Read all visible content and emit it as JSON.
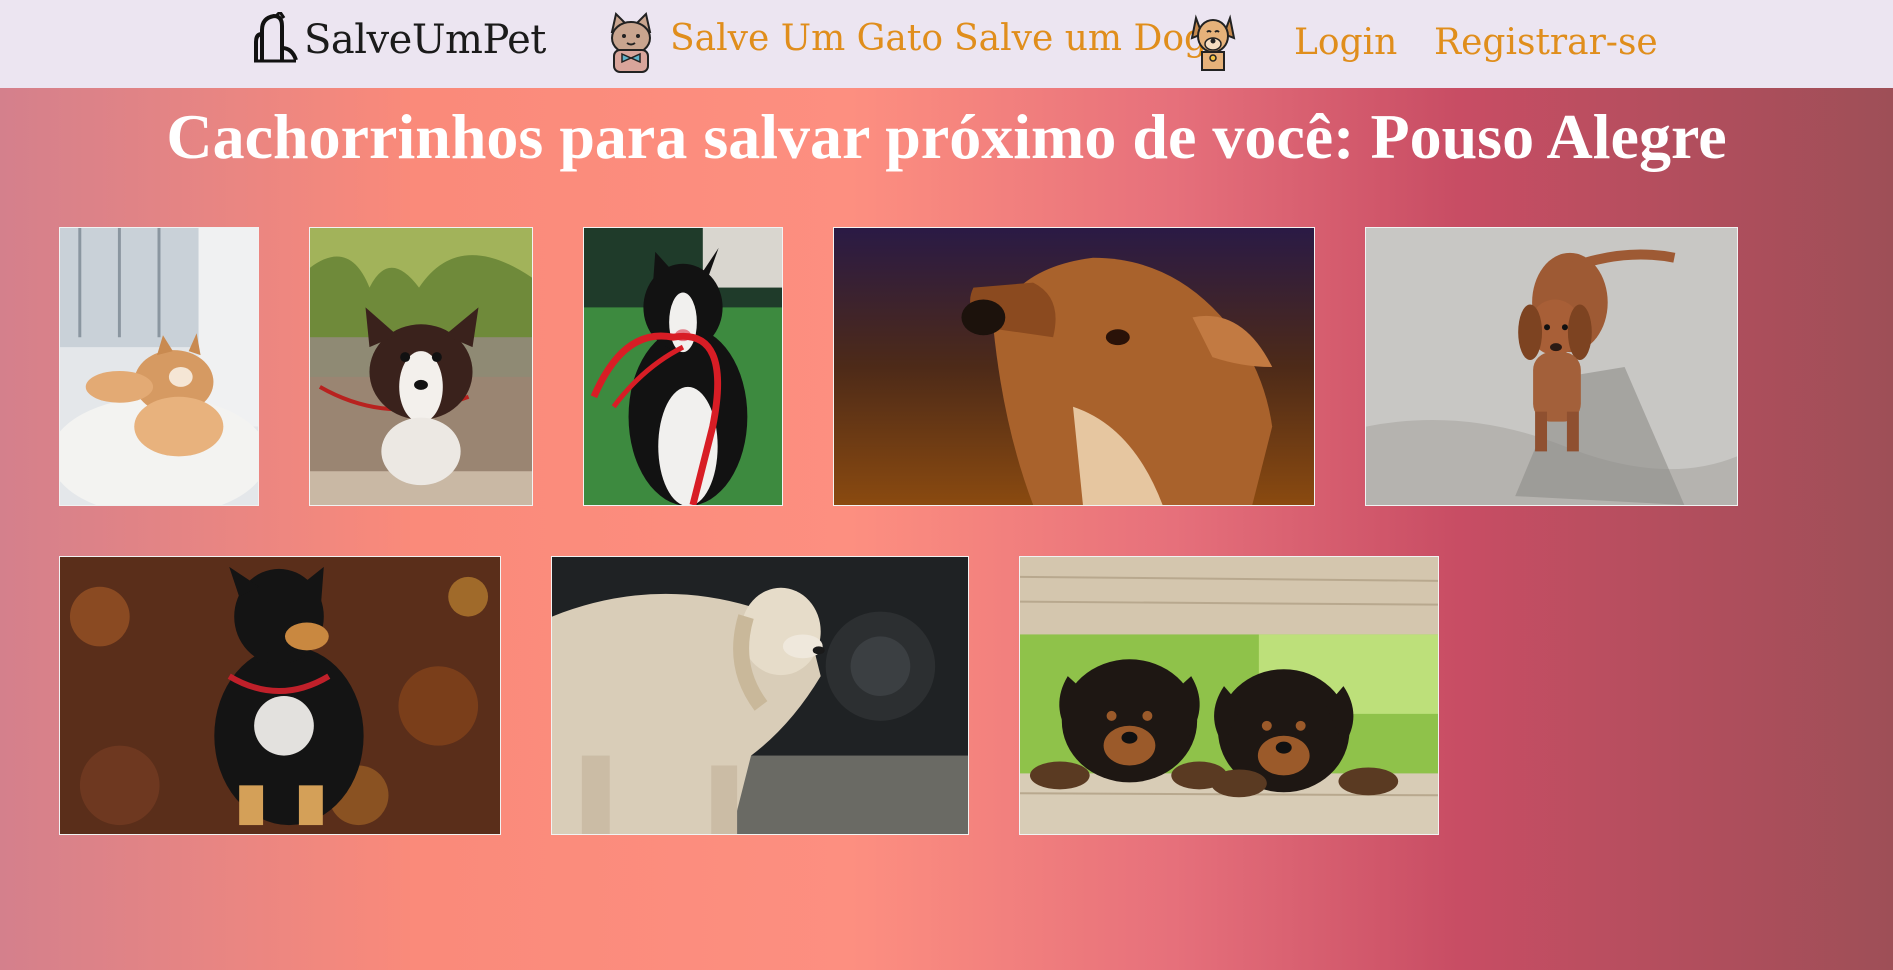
{
  "navbar": {
    "brand": "SalveUmPet",
    "cat_link": "Salve Um Gato",
    "dog_link": "Salve um Dog",
    "login": "Login",
    "register": "Registrar-se"
  },
  "page": {
    "headline": "Cachorrinhos para salvar próximo de você: Pouso Alegre"
  },
  "colors": {
    "nav_background": "#ece5f1",
    "nav_link": "#e08e1c",
    "headline": "#ffffff"
  },
  "dogs": [
    {
      "name": "dog-photo-shiba-on-rug"
    },
    {
      "name": "dog-photo-border-collie-puppy"
    },
    {
      "name": "dog-photo-border-collie-red-leash"
    },
    {
      "name": "dog-photo-brown-dog-portrait"
    },
    {
      "name": "dog-photo-dachshund"
    },
    {
      "name": "dog-photo-black-tan-dog-leaves"
    },
    {
      "name": "dog-photo-golden-dog"
    },
    {
      "name": "dog-photo-rottweiler-puppies"
    }
  ]
}
